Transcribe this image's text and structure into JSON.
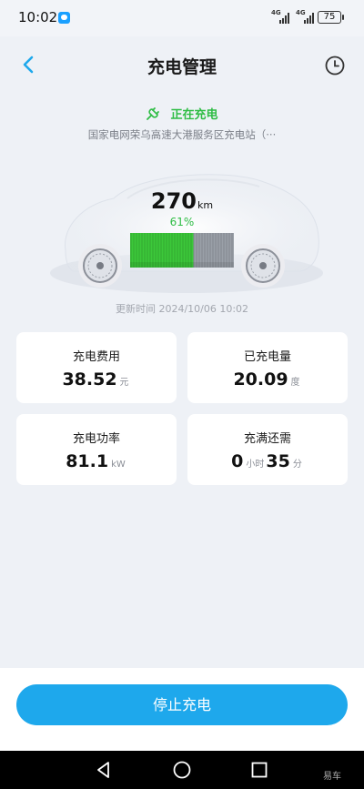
{
  "status_bar": {
    "time": "10:02",
    "signal1": "4G",
    "signal2": "4G",
    "battery": "75"
  },
  "header": {
    "title": "充电管理"
  },
  "charging": {
    "status": "正在充电",
    "station": "国家电网荣乌高速大港服务区充电站（···",
    "range_value": "270",
    "range_unit": "km",
    "soc_text": "61%",
    "soc": 0.61,
    "update_time": "更新时间 2024/10/06 10:02"
  },
  "cards": {
    "fee": {
      "label": "充电费用",
      "value": "38.52",
      "unit": "元"
    },
    "energy": {
      "label": "已充电量",
      "value": "20.09",
      "unit": "度"
    },
    "power": {
      "label": "充电功率",
      "value": "81.1",
      "unit": "kW"
    },
    "remaining": {
      "label": "充满还需",
      "hours": "0",
      "hours_unit": "小时",
      "minutes": "35",
      "minutes_unit": "分"
    }
  },
  "actions": {
    "stop_label": "停止充电"
  },
  "watermark": "易车",
  "colors": {
    "accent": "#1ea8ec",
    "charging_green": "#2fbd45",
    "background": "#eef1f6"
  },
  "icons": {
    "back": "chevron-left-icon",
    "history": "clock-icon",
    "plug": "plug-icon"
  }
}
